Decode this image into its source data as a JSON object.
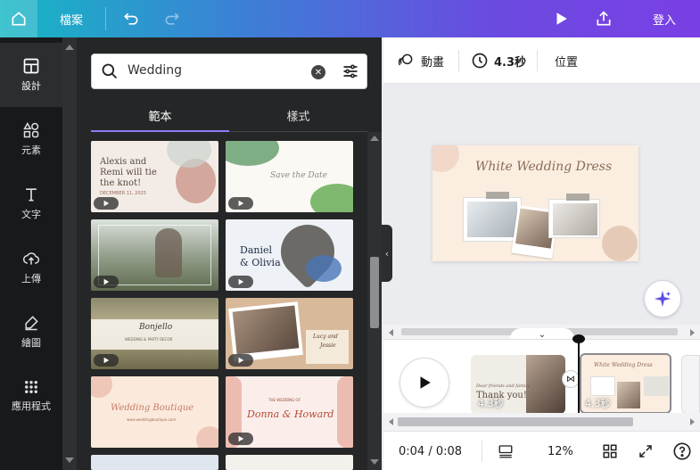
{
  "topbar": {
    "file_label": "檔案",
    "login_label": "登入"
  },
  "rail": {
    "items": [
      {
        "label": "設計",
        "icon": "layout-icon"
      },
      {
        "label": "元素",
        "icon": "shapes-icon"
      },
      {
        "label": "文字",
        "icon": "text-icon"
      },
      {
        "label": "上傳",
        "icon": "upload-cloud-icon"
      },
      {
        "label": "繪圖",
        "icon": "draw-icon"
      },
      {
        "label": "應用程式",
        "icon": "apps-grid-icon"
      }
    ]
  },
  "search": {
    "value": "Wedding"
  },
  "panel_tabs": {
    "templates": "範本",
    "styles": "樣式"
  },
  "templates": {
    "t1": {
      "line1": "Alexis and",
      "line2": "Remi will tie",
      "line3": "the knot!",
      "date": "DECEMBER 11, 2025"
    },
    "t2": {
      "line1": "Save the Date"
    },
    "t4": {
      "line1": "Daniel",
      "line2": "& Olivia"
    },
    "t5": {
      "line1": "Bonjello",
      "line2": "WEDDING & PARTY DECOR"
    },
    "t6": {
      "line1": "Lucy and",
      "line2": "Jessie"
    },
    "t7": {
      "line1": "Wedding Boutique",
      "line2": "www.weddingboutique.com"
    },
    "t8": {
      "line1": "THE WEDDING OF",
      "line2": "Donna & Howard"
    }
  },
  "editor_toolbar": {
    "animate": "動畫",
    "duration": "4.3秒",
    "position": "位置"
  },
  "canvas": {
    "title": "White Wedding Dress"
  },
  "timeline": {
    "clips": [
      {
        "label": "4.3秒",
        "text1": "Dear friends and family",
        "text2": "Thank you!"
      },
      {
        "label": "4.3秒",
        "text1": "White Wedding Dress"
      }
    ]
  },
  "bottombar": {
    "time": "0:04 / 0:08",
    "zoom": "12%"
  }
}
